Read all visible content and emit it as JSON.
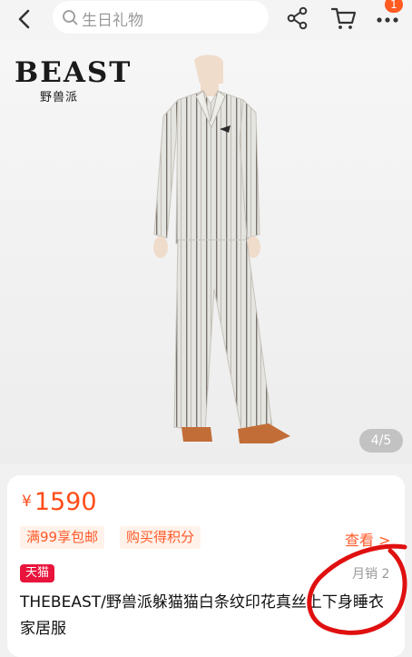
{
  "header": {
    "search_placeholder": "生日礼物",
    "cart_badge": "1"
  },
  "gallery": {
    "brand_name": "BEAST",
    "brand_subtitle": "野兽派",
    "pager": "4/5"
  },
  "product": {
    "currency": "¥",
    "price": "1590",
    "promo_tags": [
      "满99享包邮",
      "购买得积分"
    ],
    "view_link": "查看 >",
    "store_badge": "天猫",
    "monthly_sales": "月销 2",
    "title": "THEBEAST/野兽派躲猫猫白条纹印花真丝上下身睡衣家居服"
  },
  "colors": {
    "accent": "#ff4d1a",
    "tmall_red": "#e8143c",
    "annotation_red": "#e01010"
  },
  "icons": [
    "back-icon",
    "search-icon",
    "share-icon",
    "cart-icon",
    "more-icon"
  ]
}
